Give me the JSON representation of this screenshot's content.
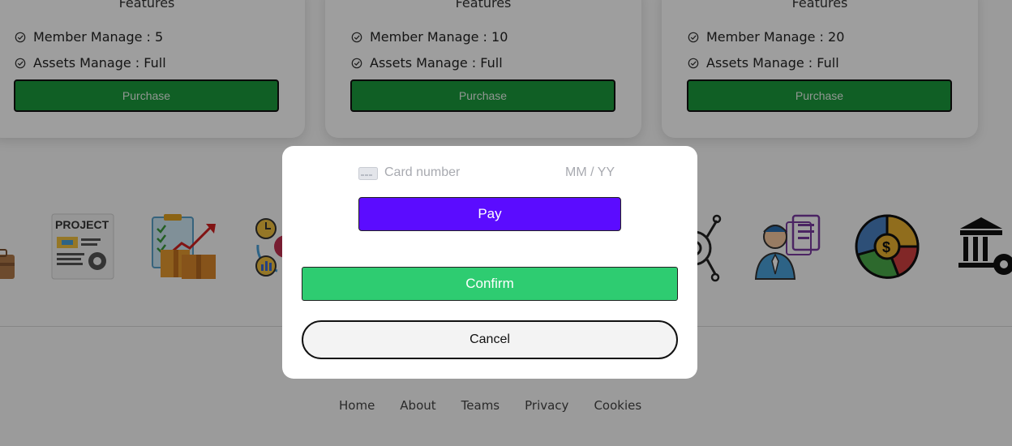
{
  "plans": [
    {
      "features_title": "Features",
      "member": "Member Manage : 5",
      "assets": "Assets Manage : Full",
      "purchase": "Purchase"
    },
    {
      "features_title": "Features",
      "member": "Member Manage : 10",
      "assets": "Assets Manage : Full",
      "purchase": "Purchase"
    },
    {
      "features_title": "Features",
      "member": "Member Manage : 20",
      "assets": "Assets Manage : Full",
      "purchase": "Purchase"
    }
  ],
  "icon_strip": {
    "project_label": "PROJECT",
    "icons": [
      "briefcase-icon",
      "project-document-icon",
      "clipboard-boxes-growth-icon",
      "clock-chart-cycle-icon",
      "gear-network-icon",
      "employee-documents-icon",
      "dollar-pie-chart-icon",
      "bank-gear-icon"
    ]
  },
  "footer": {
    "links": [
      "Home",
      "About",
      "Teams",
      "Privacy",
      "Cookies"
    ]
  },
  "payment_modal": {
    "card_number_placeholder": "Card number",
    "expiry_placeholder": "MM / YY",
    "pay": "Pay",
    "confirm": "Confirm",
    "cancel": "Cancel"
  },
  "colors": {
    "purchase": "#1a9a3c",
    "pay": "#5b0cff",
    "confirm": "#2ecc71",
    "overlay": "rgba(0,0,0,0.38)"
  }
}
